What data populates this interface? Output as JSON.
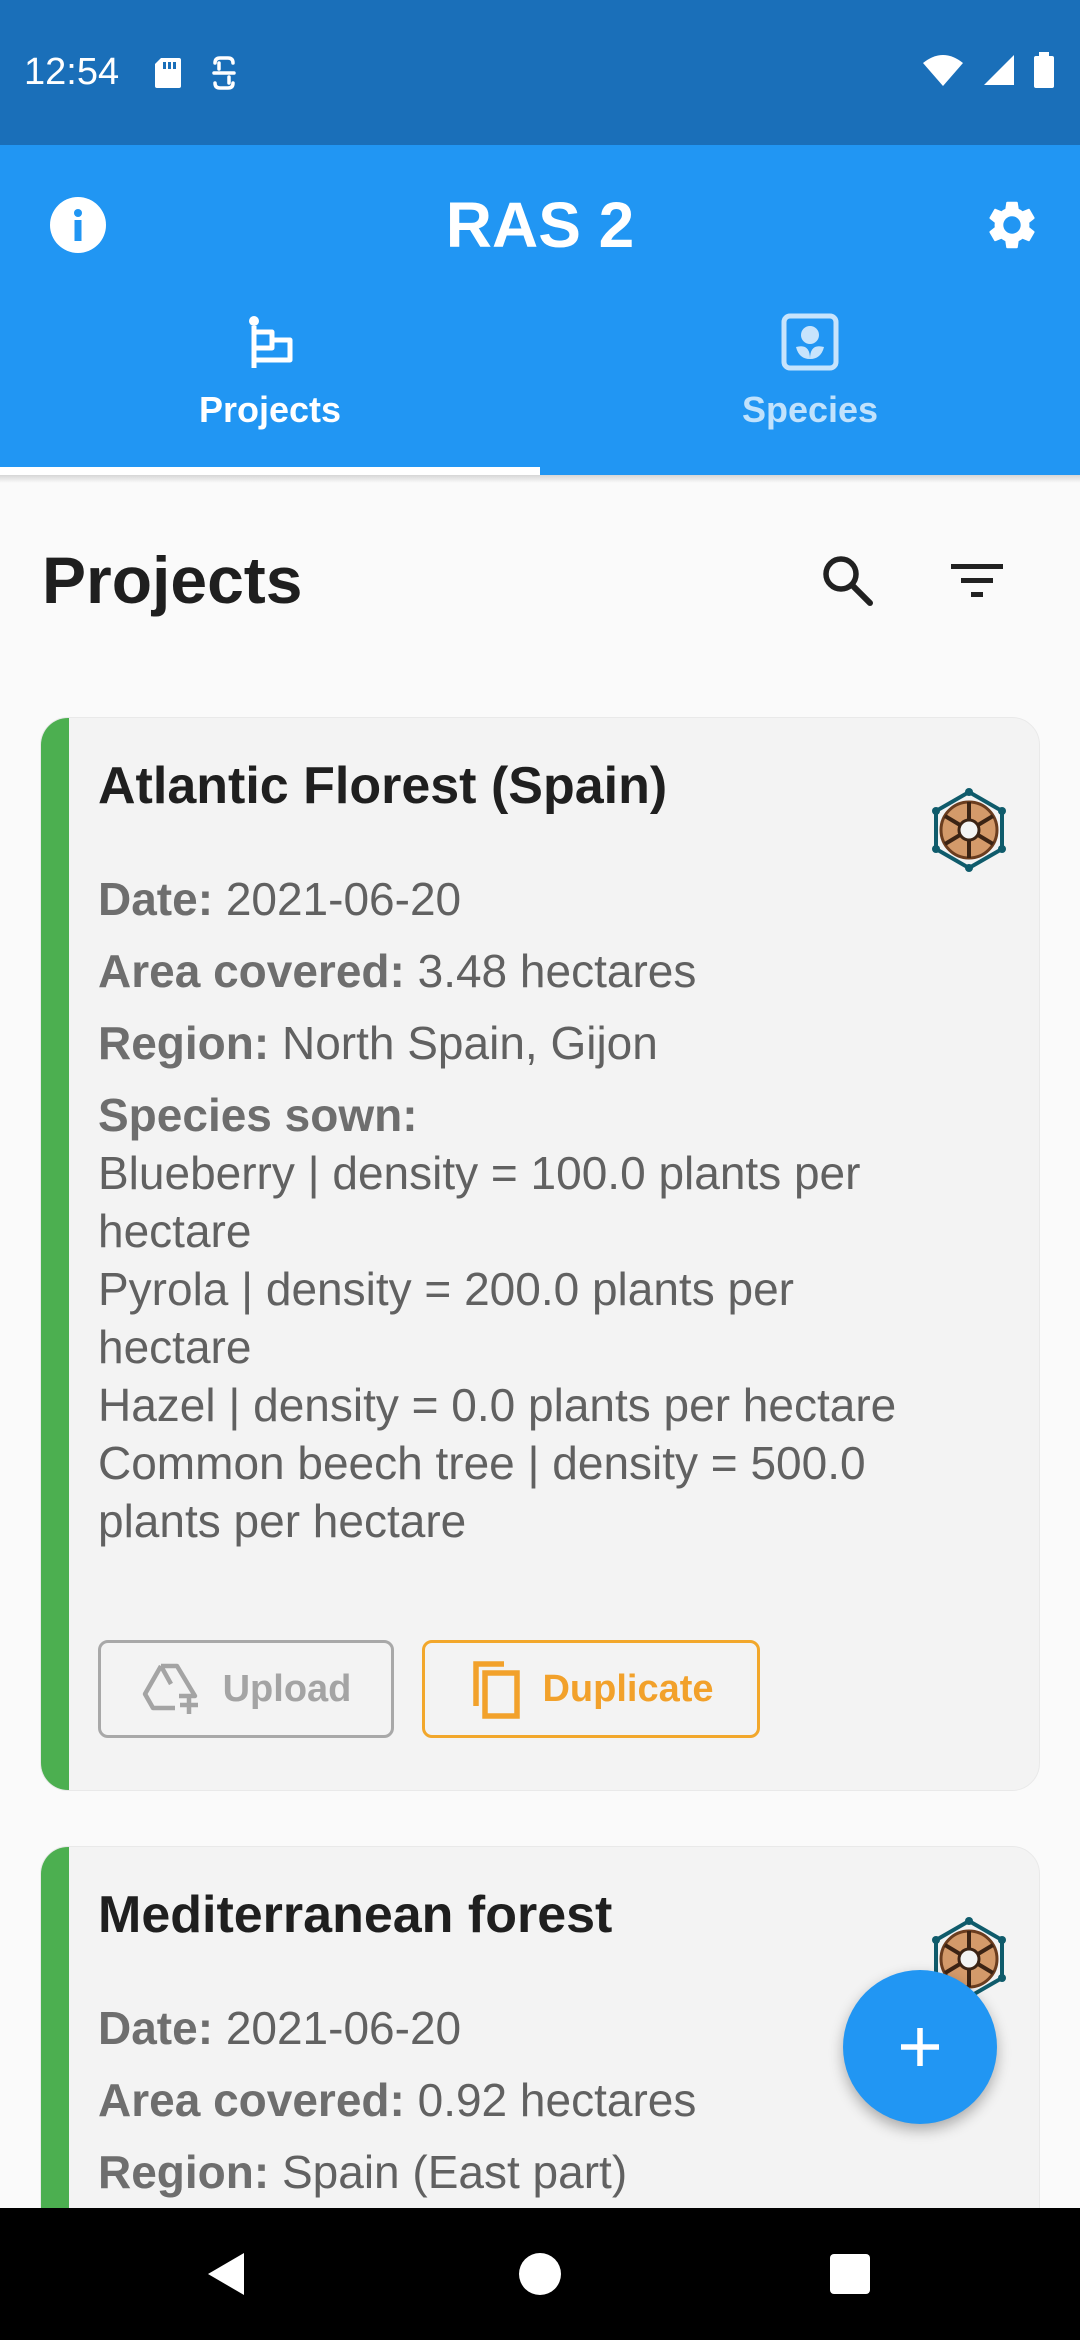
{
  "status_bar": {
    "time": "12:54"
  },
  "app_bar": {
    "title": "RAS 2"
  },
  "tabs": [
    {
      "label": "Projects",
      "icon": "project-flag-icon",
      "selected": true
    },
    {
      "label": "Species",
      "icon": "species-flower-icon",
      "selected": false
    }
  ],
  "page": {
    "title": "Projects"
  },
  "projects": [
    {
      "title": "Atlantic Florest (Spain)",
      "date_label": "Date:",
      "date": "2021-06-20",
      "area_label": "Area covered:",
      "area": "3.48 hectares",
      "region_label": "Region:",
      "region": "North Spain, Gijon",
      "species_label": "Species sown:",
      "species": [
        "Blueberry | density = 100.0 plants per hectare",
        "Pyrola | density = 200.0 plants per hectare",
        "Hazel | density = 0.0 plants per hectare",
        "Common beech tree | density = 500.0 plants per hectare"
      ],
      "upload_label": "Upload",
      "duplicate_label": "Duplicate"
    },
    {
      "title": "Mediterranean forest",
      "date_label": "Date:",
      "date": "2021-06-20",
      "area_label": "Area covered:",
      "area": "0.92 hectares",
      "region_label": "Region:",
      "region": "Spain (East part)"
    }
  ],
  "colors": {
    "status_bar": "#1a6fb9",
    "app_bar": "#2196f3",
    "card_stripe": "#4caf50",
    "duplicate": "#f2a72b",
    "fab": "#2196f3"
  }
}
